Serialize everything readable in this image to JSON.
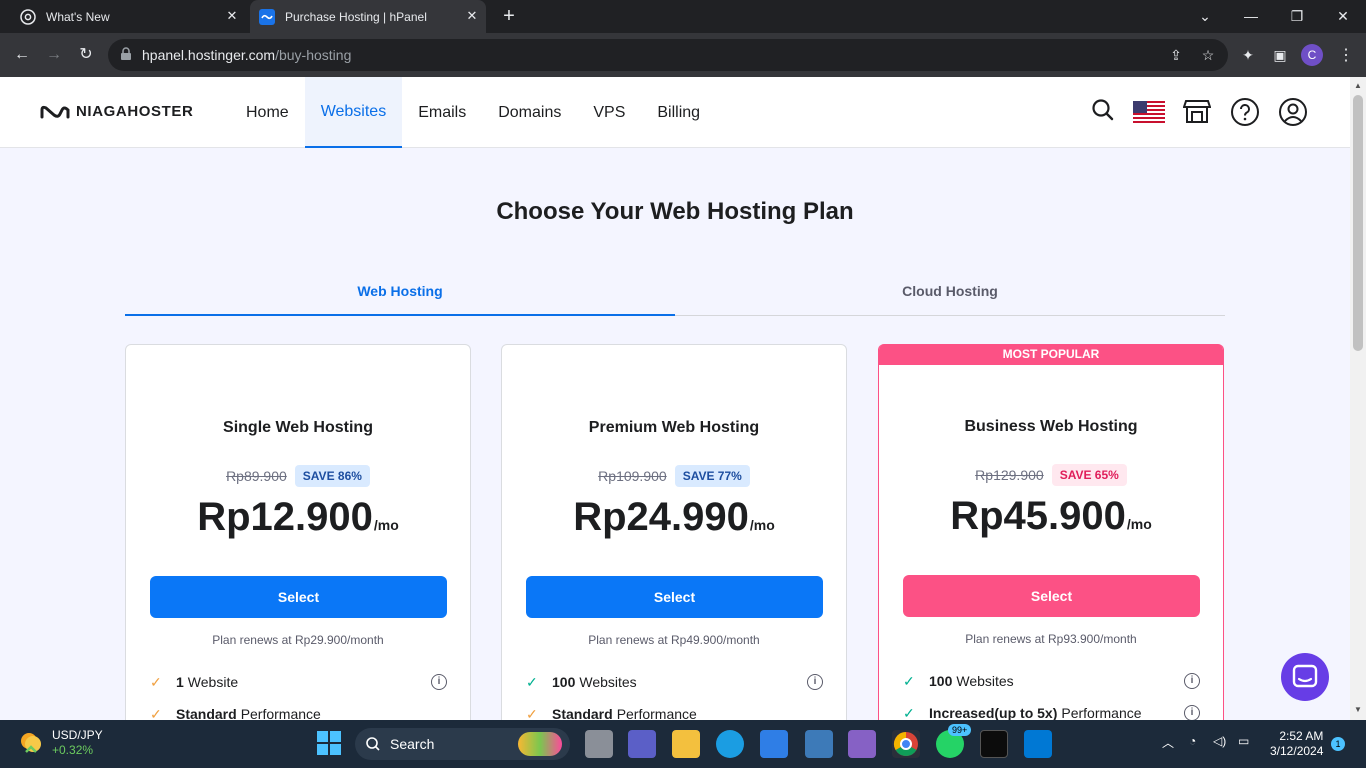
{
  "browser": {
    "tabs": [
      {
        "title": "What's New"
      },
      {
        "title": "Purchase Hosting | hPanel"
      }
    ],
    "url_host": "hpanel.hostinger.com",
    "url_path": "/buy-hosting",
    "profile_initial": "C"
  },
  "site": {
    "logo_text": "NIAGAHOSTER",
    "nav": [
      "Home",
      "Websites",
      "Emails",
      "Domains",
      "VPS",
      "Billing"
    ],
    "active_nav": "Websites"
  },
  "page": {
    "title": "Choose Your Web Hosting Plan",
    "hosting_tabs": [
      "Web Hosting",
      "Cloud Hosting"
    ],
    "active_tab": "Web Hosting"
  },
  "plans": [
    {
      "name": "Single Web Hosting",
      "old_price": "Rp89.900",
      "save": "SAVE 86%",
      "price": "Rp12.900",
      "per": "/mo",
      "button": "Select",
      "renew": "Plan renews at Rp29.900/month",
      "features": [
        {
          "bold": "1",
          "text": "Website"
        },
        {
          "bold": "Standard",
          "text": "Performance"
        }
      ]
    },
    {
      "name": "Premium Web Hosting",
      "old_price": "Rp109.900",
      "save": "SAVE 77%",
      "price": "Rp24.990",
      "per": "/mo",
      "button": "Select",
      "renew": "Plan renews at Rp49.900/month",
      "features": [
        {
          "bold": "100",
          "text": "Websites"
        },
        {
          "bold": "Standard",
          "text": "Performance"
        }
      ]
    },
    {
      "name": "Business Web Hosting",
      "ribbon": "MOST POPULAR",
      "old_price": "Rp129.900",
      "save": "SAVE 65%",
      "price": "Rp45.900",
      "per": "/mo",
      "button": "Select",
      "renew": "Plan renews at Rp93.900/month",
      "features": [
        {
          "bold": "100",
          "text": "Websites"
        },
        {
          "bold": "Increased(up to 5x)",
          "text": "Performance"
        }
      ]
    }
  ],
  "colors": {
    "primary": "#0a77f7",
    "popular": "#fc5185",
    "nav_active": "#0a6fe8"
  },
  "taskbar": {
    "ticker_pair": "USD/JPY",
    "ticker_change": "+0.32%",
    "search_label": "Search",
    "whatsapp_badge": "99+",
    "time": "2:52 AM",
    "date": "3/12/2024",
    "notifications": "1"
  }
}
